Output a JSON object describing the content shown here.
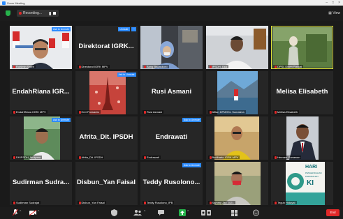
{
  "titlebar": {
    "title": "Zoom Meeting"
  },
  "recording": {
    "label": "Recording..."
  },
  "view_label": "View",
  "tiles": [
    {
      "name": "",
      "label": "Rohimin Saleh",
      "ask": "Ask to Unmute"
    },
    {
      "name": "Direktorat IGRK...",
      "label": "Direktorat IGRK MPV",
      "ask": "Unmute"
    },
    {
      "name": "",
      "label": "Bang Bagaskoro",
      "ask": ""
    },
    {
      "name": "",
      "label": "IPSDH_Eka",
      "ask": ""
    },
    {
      "name": "",
      "label": "DPSL Dirjen Rakyat",
      "ask": ""
    },
    {
      "name": "EndahRiana IGR...",
      "label": "EndahRiana IGRK MPV",
      "ask": ""
    },
    {
      "name": "",
      "label": "Heri Purwanto",
      "ask": "Ask to Unmute"
    },
    {
      "name": "Rusi Asmani",
      "label": "Rusi Asmani",
      "ask": ""
    },
    {
      "name": "",
      "label": "Alfian DPMHKL Sumatera",
      "ask": ""
    },
    {
      "name": "Melisa Elisabeth",
      "label": "Melisa Elisabeth",
      "ask": ""
    },
    {
      "name": "",
      "label": "DKIPSDH_Mulyono",
      "ask": "Ask to Unmute"
    },
    {
      "name": "Afrita_Dit. IPSDH",
      "label": "Afrita_Dit. IPSDH",
      "ask": ""
    },
    {
      "name": "Endrawati",
      "label": "Endrawati",
      "ask": "Ask to Unmute"
    },
    {
      "name": "",
      "label": "Budiharto IGRK MPV",
      "ask": ""
    },
    {
      "name": "",
      "label": "Hermen Gunawan",
      "ask": ""
    },
    {
      "name": "Sudirman Sudra...",
      "label": "Sudirman Sudrajat",
      "ask": ""
    },
    {
      "name": "Disbun_Yan Faisal",
      "label": "Disbun_Yan Faisal",
      "ask": ""
    },
    {
      "name": "Teddy Rusolono...",
      "label": "Teddy Rusolono_IPB",
      "ask": "Ask to Unmute"
    },
    {
      "name": "",
      "label": "Sammy Jan 2021",
      "ask": ""
    },
    {
      "name": "",
      "label": "Teguh Hidayat",
      "ask": ""
    }
  ],
  "poster": {
    "line1": "HARI",
    "line2": "KI",
    "line3": "PENGENDALIAN",
    "line4": "PERUBAHAN"
  },
  "toolbar": {
    "end_label": "End"
  },
  "colors": {
    "accent": "#2d8cff",
    "active": "#dfe63a",
    "muted": "#e02828",
    "end": "#e02828",
    "security": "#26b34b"
  }
}
